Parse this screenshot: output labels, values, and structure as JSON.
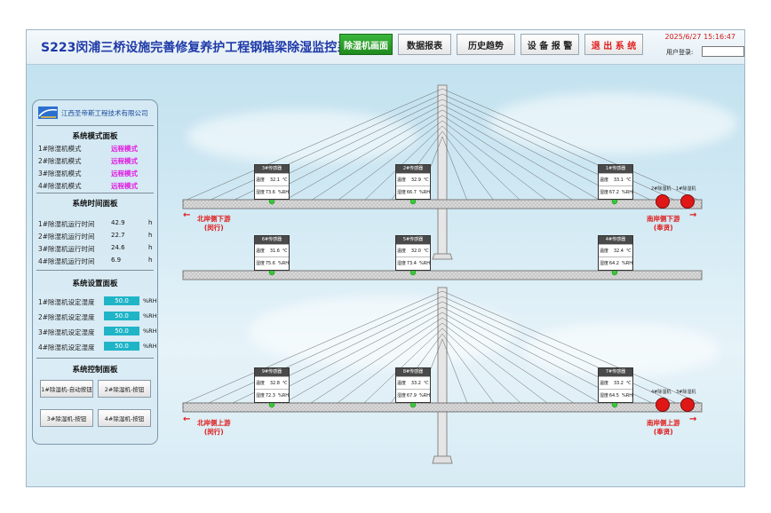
{
  "app": {
    "title": "S223闵浦三桥设施完善修复养护工程钢箱梁除湿监控系统",
    "datetime": "2025/6/27 15:16:47",
    "login_label": "用户登录:",
    "login_value": ""
  },
  "nav": [
    {
      "label": "除湿机画面",
      "active": true
    },
    {
      "label": "数据报表",
      "active": false
    },
    {
      "label": "历史趋势",
      "active": false
    },
    {
      "label": "设 备 报 警",
      "active": false
    },
    {
      "label": "退 出 系 统",
      "active": false
    }
  ],
  "panel": {
    "company": "江西圣帝斯工程技术有限公司",
    "mode_title": "系统模式面板",
    "modes": [
      {
        "label": "1#除湿机模式",
        "value": "远程模式"
      },
      {
        "label": "2#除湿机模式",
        "value": "远程模式"
      },
      {
        "label": "3#除湿机模式",
        "value": "远程模式"
      },
      {
        "label": "4#除湿机模式",
        "value": "远程模式"
      }
    ],
    "time_title": "系统时间面板",
    "times": [
      {
        "label": "1#除湿机运行时间",
        "value": "42.9",
        "unit": "h"
      },
      {
        "label": "2#除湿机运行时间",
        "value": "22.7",
        "unit": "h"
      },
      {
        "label": "3#除湿机运行时间",
        "value": "24.6",
        "unit": "h"
      },
      {
        "label": "4#除湿机运行时间",
        "value": "6.9",
        "unit": "h"
      }
    ],
    "settings_title": "系统设置面板",
    "settings": [
      {
        "label": "1#除湿机设定湿度",
        "value": "50.0",
        "unit": "%RH"
      },
      {
        "label": "2#除湿机设定湿度",
        "value": "50.0",
        "unit": "%RH"
      },
      {
        "label": "3#除湿机设定湿度",
        "value": "50.0",
        "unit": "%RH"
      },
      {
        "label": "4#除湿机设定湿度",
        "value": "50.0",
        "unit": "%RH"
      }
    ],
    "control_title": "系统控制面板",
    "controls": [
      {
        "label": "1#除湿机-自动按钮"
      },
      {
        "label": "2#除湿机-按钮"
      },
      {
        "label": "3#除湿机-按钮"
      },
      {
        "label": "4#除湿机-按钮"
      }
    ]
  },
  "sensors": [
    {
      "name": "3#传感器",
      "temp": "32.1",
      "temp_unit": "℃",
      "hum": "73.6",
      "hum_unit": "%RH",
      "temp_label": "温度",
      "hum_label": "湿度"
    },
    {
      "name": "2#传感器",
      "temp": "32.9",
      "temp_unit": "℃",
      "hum": "66.7",
      "hum_unit": "%RH",
      "temp_label": "温度",
      "hum_label": "湿度"
    },
    {
      "name": "1#传感器",
      "temp": "33.1",
      "temp_unit": "℃",
      "hum": "67.2",
      "hum_unit": "%RH",
      "temp_label": "温度",
      "hum_label": "湿度"
    },
    {
      "name": "6#传感器",
      "temp": "31.6",
      "temp_unit": "℃",
      "hum": "75.6",
      "hum_unit": "%RH",
      "temp_label": "温度",
      "hum_label": "湿度"
    },
    {
      "name": "5#传感器",
      "temp": "32.0",
      "temp_unit": "℃",
      "hum": "73.4",
      "hum_unit": "%RH",
      "temp_label": "温度",
      "hum_label": "湿度"
    },
    {
      "name": "4#传感器",
      "temp": "32.4",
      "temp_unit": "℃",
      "hum": "64.2",
      "hum_unit": "%RH",
      "temp_label": "温度",
      "hum_label": "湿度"
    },
    {
      "name": "9#传感器",
      "temp": "32.8",
      "temp_unit": "℃",
      "hum": "72.3",
      "hum_unit": "%RH",
      "temp_label": "温度",
      "hum_label": "湿度"
    },
    {
      "name": "8#传感器",
      "temp": "33.2",
      "temp_unit": "℃",
      "hum": "67.9",
      "hum_unit": "%RH",
      "temp_label": "温度",
      "hum_label": "湿度"
    },
    {
      "name": "7#传感器",
      "temp": "33.2",
      "temp_unit": "℃",
      "hum": "64.5",
      "hum_unit": "%RH",
      "temp_label": "温度",
      "hum_label": "湿度"
    }
  ],
  "dehumidifiers": [
    {
      "label": "2#除湿机"
    },
    {
      "label": "1#除湿机"
    },
    {
      "label": "4#除湿机"
    },
    {
      "label": "3#除湿机"
    }
  ],
  "directions": {
    "north_down": "北岸侧下游",
    "north_down_sub": "(闵行)",
    "south_down": "南岸侧下游",
    "south_down_sub": "(奉贤)",
    "north_up": "北岸侧上游",
    "north_up_sub": "(闵行)",
    "south_up": "南岸侧上游",
    "south_up_sub": "(奉贤)"
  },
  "colors": {
    "accent_title": "#1f3aa8",
    "active_nav": "#2aa02a",
    "alarm_red": "#e01c1c",
    "mode_magenta": "#e11ce1",
    "set_box": "#1fb5c7",
    "status_green": "#37c837"
  }
}
